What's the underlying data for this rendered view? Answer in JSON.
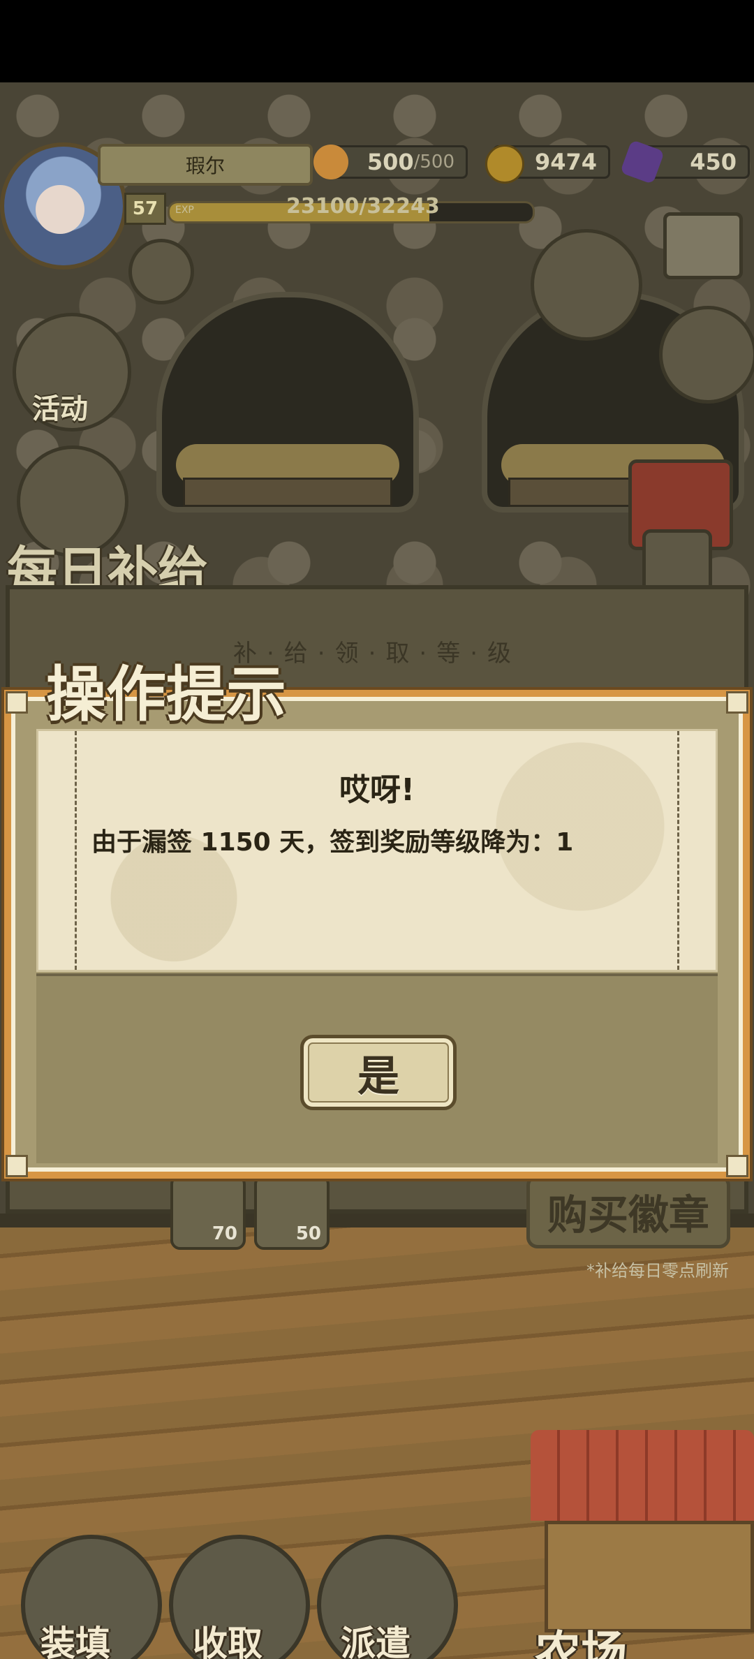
{
  "hud": {
    "player_name": "瑕尔",
    "level": "57",
    "exp_tag": "EXP",
    "exp_text": "23100/32243",
    "exp_progress": 0.716,
    "bread_current": "500",
    "bread_max": "/500",
    "gold": "9474",
    "gems": "450"
  },
  "side": {
    "activity_label": "活动"
  },
  "supply": {
    "title": "每日补给",
    "subtitle": "补·给·领·取·等·级",
    "slot1_count": "70",
    "slot2_count": "50",
    "buy_label": "购买徽章",
    "refresh_note": "*补给每日零点刷新"
  },
  "dialog": {
    "title": "操作提示",
    "heading": "哎呀!",
    "message": "由于漏签 1150 天，签到奖励等级降为：1",
    "confirm_label": "是"
  },
  "bottom_bar": {
    "load_label": "装填",
    "collect_label": "收取",
    "dispatch_label": "派遣",
    "farm_label": "农场"
  },
  "colors": {
    "modal_border_orange": "#d79644",
    "paper": "#ede4c9",
    "button_face": "#ddd2a9"
  }
}
